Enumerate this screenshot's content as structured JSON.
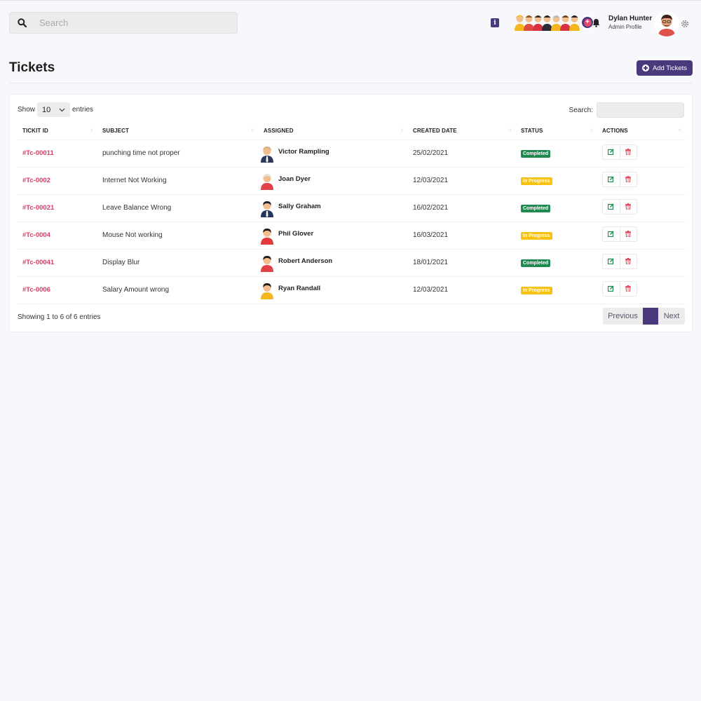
{
  "header": {
    "search_placeholder": "Search",
    "info_label": "i",
    "team_more": "+",
    "user_name": "Dylan Hunter",
    "user_role": "Admin Profile"
  },
  "page": {
    "title": "Tickets",
    "add_button": "Add Tickets"
  },
  "table_controls": {
    "show_label": "Show",
    "entries_value": "10",
    "entries_label": "entries",
    "search_label": "Search:",
    "info": "Showing 1 to 6 of 6 entries",
    "prev": "Previous",
    "current_page": "",
    "next": "Next"
  },
  "columns": [
    "TICKIT ID",
    "SUBJECT",
    "ASSIGNED",
    "CREATED DATE",
    "STATUS",
    "ACTIONS"
  ],
  "tickets": [
    {
      "id": "#Tc-00011",
      "subject": "punching time not proper",
      "assigned": "Victor Rampling",
      "date": "25/02/2021",
      "status": "Completed"
    },
    {
      "id": "#Tc-0002",
      "subject": "Internet Not Working",
      "assigned": "Joan Dyer",
      "date": "12/03/2021",
      "status": "In Progress"
    },
    {
      "id": "#Tc-00021",
      "subject": "Leave Balance Wrong",
      "assigned": "Sally Graham",
      "date": "16/02/2021",
      "status": "Completed"
    },
    {
      "id": "#Tc-0004",
      "subject": "Mouse Not working",
      "assigned": "Phil Glover",
      "date": "16/03/2021",
      "status": "In Progress"
    },
    {
      "id": "#Tc-00041",
      "subject": "Display Blur",
      "assigned": "Robert Anderson",
      "date": "18/01/2021",
      "status": "Completed"
    },
    {
      "id": "#Tc-0006",
      "subject": "Salary Amount wrong",
      "assigned": "Ryan Randall",
      "date": "12/03/2021",
      "status": "In Progress"
    }
  ],
  "colors": {
    "primary": "#4a3a7d",
    "ticket_id": "#d63d64",
    "completed": "#1f8a4f",
    "in_progress": "#f7c213",
    "edit_icon": "#1f8a4f",
    "delete_icon": "#e0364b"
  },
  "icons": {
    "search": "search-icon",
    "info": "info-icon",
    "bell": "bell-icon",
    "gear": "gear-icon",
    "add": "plus-circle-icon",
    "edit": "edit-icon",
    "delete": "trash-icon",
    "sort": "sort-icon"
  }
}
